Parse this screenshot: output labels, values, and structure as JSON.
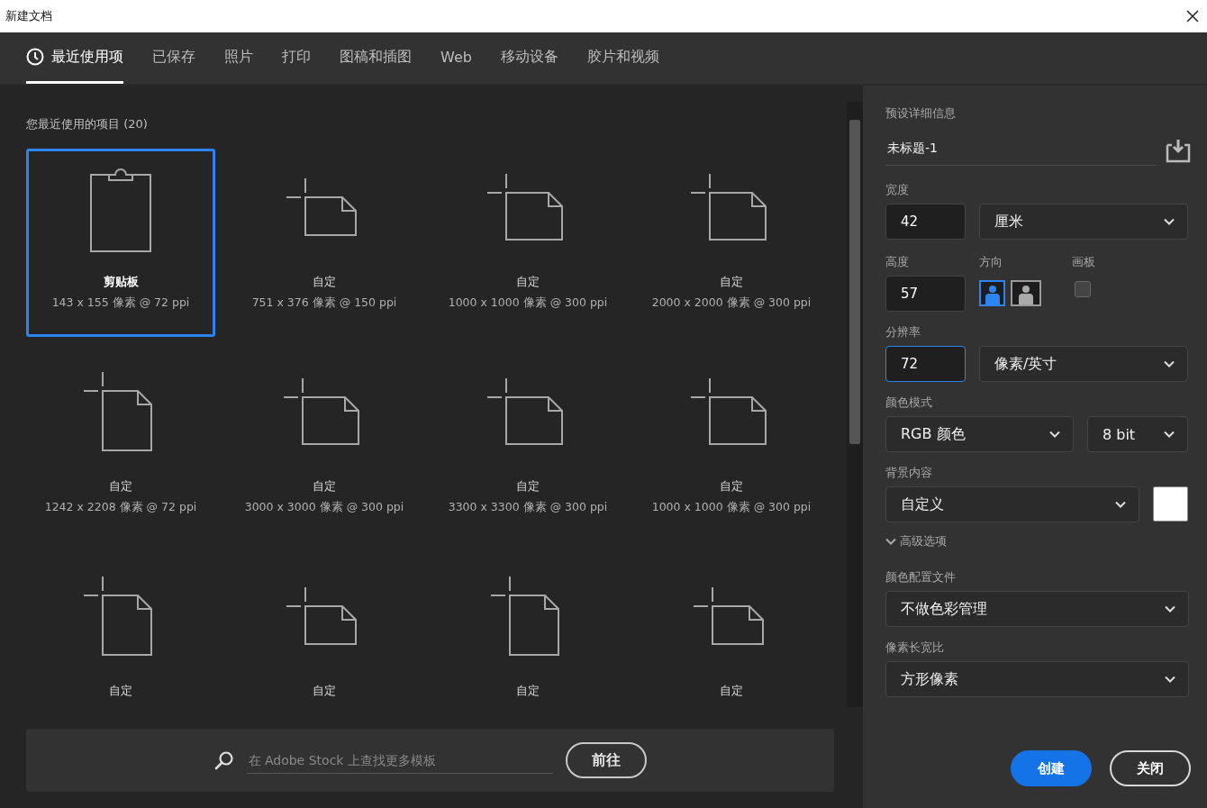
{
  "window": {
    "title": "新建文档"
  },
  "tabs": [
    {
      "label": "最近使用项",
      "selected": true
    },
    {
      "label": "已保存",
      "selected": false
    },
    {
      "label": "照片",
      "selected": false
    },
    {
      "label": "打印",
      "selected": false
    },
    {
      "label": "图稿和插图",
      "selected": false
    },
    {
      "label": "Web",
      "selected": false
    },
    {
      "label": "移动设备",
      "selected": false
    },
    {
      "label": "胶片和视频",
      "selected": false
    }
  ],
  "recent": {
    "heading": "您最近使用的项目",
    "count": "(20)",
    "presets": [
      {
        "kind": "clipboard",
        "name": "剪贴板",
        "details": "143 x 155 像素 @ 72 ppi",
        "selected": true
      },
      {
        "kind": "wide",
        "name": "自定",
        "details": "751 x 376 像素 @ 150 ppi",
        "selected": false
      },
      {
        "kind": "square",
        "name": "自定",
        "details": "1000 x 1000 像素 @ 300 ppi",
        "selected": false
      },
      {
        "kind": "square",
        "name": "自定",
        "details": "2000 x 2000 像素 @ 300 ppi",
        "selected": false
      },
      {
        "kind": "tall",
        "name": "自定",
        "details": "1242 x 2208 像素 @ 72 ppi",
        "selected": false
      },
      {
        "kind": "square",
        "name": "自定",
        "details": "3000 x 3000 像素 @ 300 ppi",
        "selected": false
      },
      {
        "kind": "square",
        "name": "自定",
        "details": "3300 x 3300 像素 @ 300 ppi",
        "selected": false
      },
      {
        "kind": "square",
        "name": "自定",
        "details": "1000 x 1000 像素 @ 300 ppi",
        "selected": false
      },
      {
        "kind": "tall",
        "name": "自定",
        "selected": false
      },
      {
        "kind": "wide",
        "name": "自定",
        "selected": false
      },
      {
        "kind": "tall",
        "name": "自定",
        "selected": false
      },
      {
        "kind": "wide",
        "name": "自定",
        "selected": false
      }
    ]
  },
  "stock_search": {
    "placeholder": "在 Adobe Stock 上查找更多模板",
    "button": "前往"
  },
  "details": {
    "heading": "预设详细信息",
    "name": "未标题-1",
    "width": {
      "label": "宽度",
      "value": "42",
      "unit": "厘米"
    },
    "height": {
      "label": "高度",
      "value": "57"
    },
    "orientation": {
      "label": "方向",
      "options": [
        {
          "kind": "portrait",
          "selected": true
        },
        {
          "kind": "landscape",
          "selected": false
        }
      ]
    },
    "artboard": {
      "label": "画板",
      "checked": false
    },
    "resolution": {
      "label": "分辨率",
      "value": "72",
      "unit": "像素/英寸",
      "focused": true
    },
    "color_mode": {
      "label": "颜色模式",
      "mode": "RGB 颜色",
      "depth": "8 bit"
    },
    "background": {
      "label": "背景内容",
      "value": "自定义",
      "color": "#ffffff"
    },
    "advanced": {
      "label": "高级选项",
      "expanded": true
    },
    "color_profile": {
      "label": "颜色配置文件",
      "value": "不做色彩管理"
    },
    "pixel_aspect": {
      "label": "像素长宽比",
      "value": "方形像素"
    }
  },
  "buttons": [
    {
      "label": "创建",
      "kind": "primary"
    },
    {
      "label": "关闭",
      "kind": "secondary"
    }
  ]
}
